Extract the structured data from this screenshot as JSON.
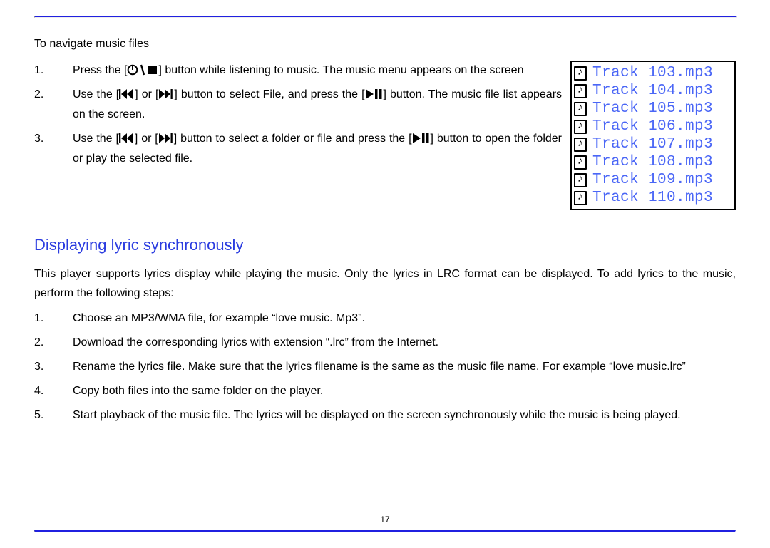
{
  "intro": "To navigate music files",
  "nav_steps": {
    "s1a": "Press the [",
    "s1b": "] button while listening to music. The music menu appears on the screen",
    "s2a": "Use the [",
    "s2b": "] or [",
    "s2c": "] button to select ",
    "s2file": "File",
    "s2d": ", and press the [",
    "s2e": "] button. The music file list appears on the screen.",
    "s3a": "Use the [",
    "s3b": "] or [",
    "s3c": "] button to select a folder or file and press the [",
    "s3d": "] button to open the folder or play the selected file."
  },
  "track_panel": {
    "items": [
      "Track 103.mp3",
      "Track 104.mp3",
      "Track 105.mp3",
      "Track 106.mp3",
      "Track 107.mp3",
      "Track 108.mp3",
      "Track 109.mp3",
      "Track 110.mp3"
    ]
  },
  "lyrics_section": {
    "heading": "Displaying lyric synchronously",
    "intro": "This player supports lyrics display while playing the music. Only the lyrics in LRC format can be displayed. To add lyrics to the music, perform the following steps:",
    "steps": {
      "s1": "Choose an MP3/WMA file, for example “love music. Mp3”.",
      "s2": "Download the corresponding lyrics with extension “.lrc” from the Internet.",
      "s3": "Rename the lyrics file. Make sure that the lyrics filename is the same as the music file name. For example “love music.lrc”",
      "s4": "Copy both files into the same folder on the player.",
      "s5": "Start playback of the music file. The lyrics will be displayed on the screen synchronously while the music is being played."
    }
  },
  "page_number": "17"
}
